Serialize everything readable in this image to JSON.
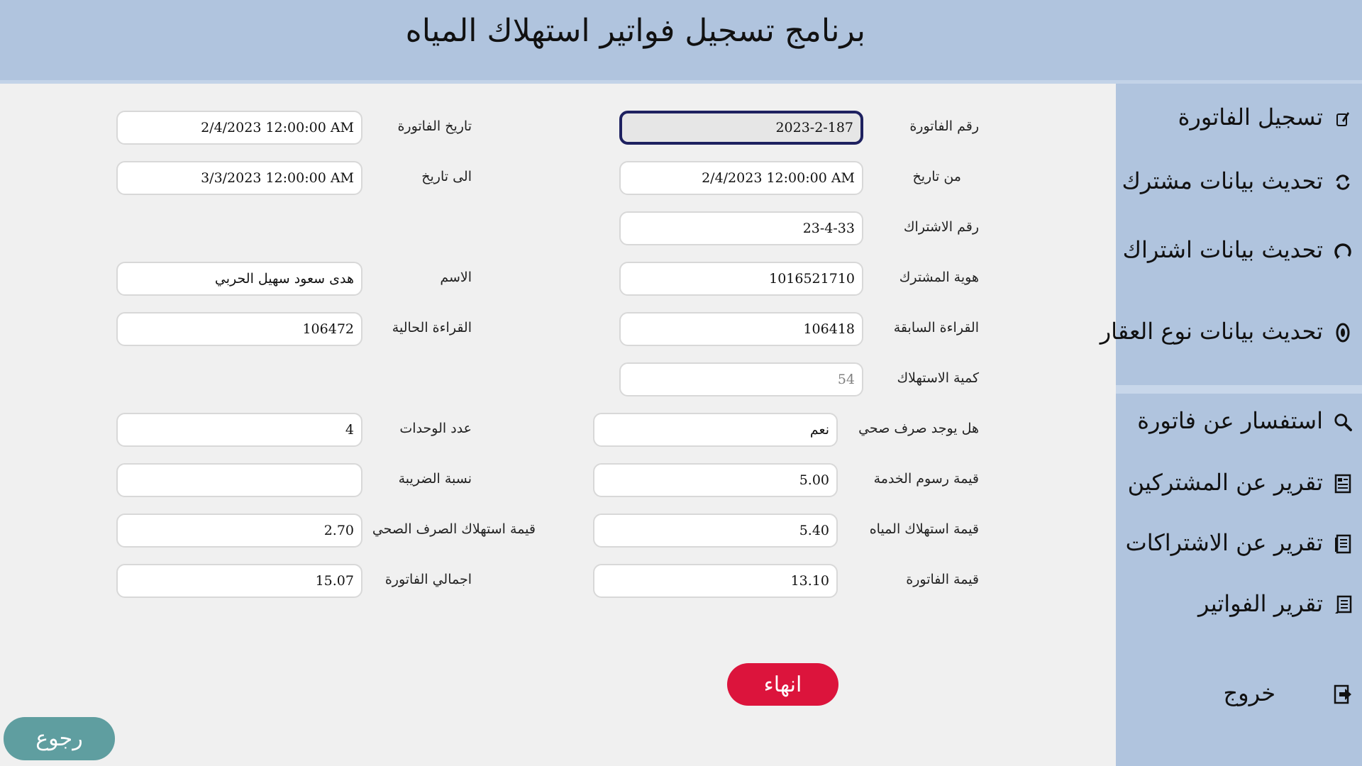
{
  "app": {
    "title": "برنامج تسجيل فواتير استهلاك المياه"
  },
  "sidebar": {
    "items": [
      {
        "label": "تسجيل الفاتورة",
        "icon": "edit-icon"
      },
      {
        "label": "تحديث بيانات مشترك",
        "icon": "refresh-icon"
      },
      {
        "label": "تحديث بيانات اشتراك",
        "icon": "cycle-icon"
      },
      {
        "label": "تحديث بيانات نوع العقار",
        "icon": "location-icon"
      },
      {
        "label": "استفسار عن فاتورة",
        "icon": "search-icon"
      },
      {
        "label": "تقرير عن المشتركين",
        "icon": "report-icon"
      },
      {
        "label": "تقرير عن الاشتراكات",
        "icon": "report-icon"
      },
      {
        "label": "تقرير الفواتير",
        "icon": "report-icon"
      },
      {
        "label": "خروج",
        "icon": "exit-icon"
      }
    ]
  },
  "form": {
    "invoice_number": {
      "label": "رقم الفاتورة",
      "value": "2023-2-187"
    },
    "from_date": {
      "label": "من تاريخ",
      "value": "2/4/2023 12:00:00 AM"
    },
    "subscription_number": {
      "label": "رقم الاشتراك",
      "value": "23-4-33"
    },
    "subscriber_id": {
      "label": "هوية المشترك",
      "value": "1016521710"
    },
    "previous_reading": {
      "label": "القراءة السابقة",
      "value": "106418"
    },
    "consumption": {
      "label": "كمية الاستهلاك",
      "value": "54"
    },
    "sewage": {
      "label": "هل يوجد صرف صحي",
      "value": "نعم"
    },
    "service_fee": {
      "label": "قيمة رسوم الخدمة",
      "value": "5.00"
    },
    "water_cost": {
      "label": "قيمة استهلاك المياه",
      "value": "5.40"
    },
    "invoice_value": {
      "label": "قيمة الفاتورة",
      "value": "13.10"
    },
    "invoice_date": {
      "label": "تاريخ الفاتورة",
      "value": "2/4/2023 12:00:00 AM"
    },
    "to_date": {
      "label": "الى تاريخ",
      "value": "3/3/2023 12:00:00 AM"
    },
    "name": {
      "label": "الاسم",
      "value": "هدى سعود سهيل الحربي"
    },
    "current_reading": {
      "label": "القراءة الحالية",
      "value": "106472"
    },
    "units": {
      "label": "عدد الوحدات",
      "value": "4"
    },
    "tax_rate": {
      "label": "نسبة الضريبة",
      "value": ""
    },
    "sewage_cost": {
      "label": "قيمة استهلاك الصرف الصحي",
      "value": "2.70"
    },
    "invoice_total": {
      "label": "اجمالي الفاتورة",
      "value": "15.07"
    }
  },
  "buttons": {
    "finish": "انهاء",
    "back": "رجوع"
  },
  "colors": {
    "header_bg": "#b0c4de",
    "sidebar_bg": "#b0c4de",
    "content_bg": "#f0f0f0",
    "finish_button": "#dc143c",
    "back_button": "#5f9ea0",
    "focus_border": "#1e2160"
  }
}
